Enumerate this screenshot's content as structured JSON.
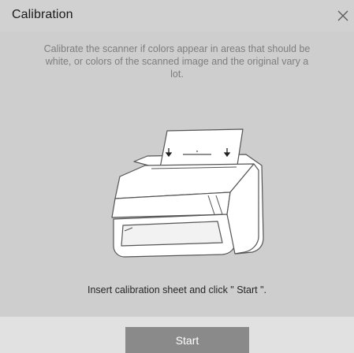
{
  "dialog": {
    "title": "Calibration",
    "description": "Calibrate the scanner if colors appear in areas that should be white, or colors of the scanned image and the original vary a lot.",
    "instruction": "Insert calibration sheet and click \" Start \".",
    "start_label": "Start",
    "icons": {
      "close": "close-icon",
      "illustration": "scanner-illustration"
    }
  }
}
